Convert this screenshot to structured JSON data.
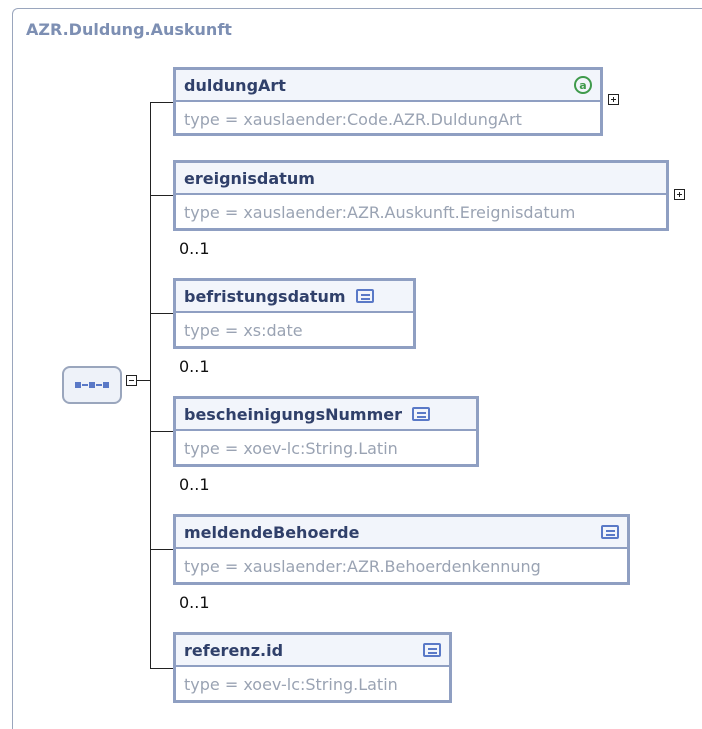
{
  "title": "AZR.Duldung.Auskunft",
  "elements": [
    {
      "name": "duldungArt",
      "type": "type = xauslaender:Code.AZR.DuldungArt",
      "icon": "attribute-icon",
      "icon_glyph": "a",
      "cardinality": ""
    },
    {
      "name": "ereignisdatum",
      "type": "type = xauslaender:AZR.Auskunft.Ereignisdatum",
      "icon": "",
      "cardinality": "0..1"
    },
    {
      "name": "befristungsdatum",
      "type": "type = xs:date",
      "icon": "documentation-icon",
      "cardinality": "0..1"
    },
    {
      "name": "bescheinigungsNummer",
      "type": "type = xoev-lc:String.Latin",
      "icon": "documentation-icon",
      "cardinality": "0..1"
    },
    {
      "name": "meldendeBehoerde",
      "type": "type = xauslaender:AZR.Behoerdenkennung",
      "icon": "documentation-icon",
      "cardinality": "0..1"
    },
    {
      "name": "referenz.id",
      "type": "type = xoev-lc:String.Latin",
      "icon": "documentation-icon",
      "cardinality": ""
    }
  ]
}
